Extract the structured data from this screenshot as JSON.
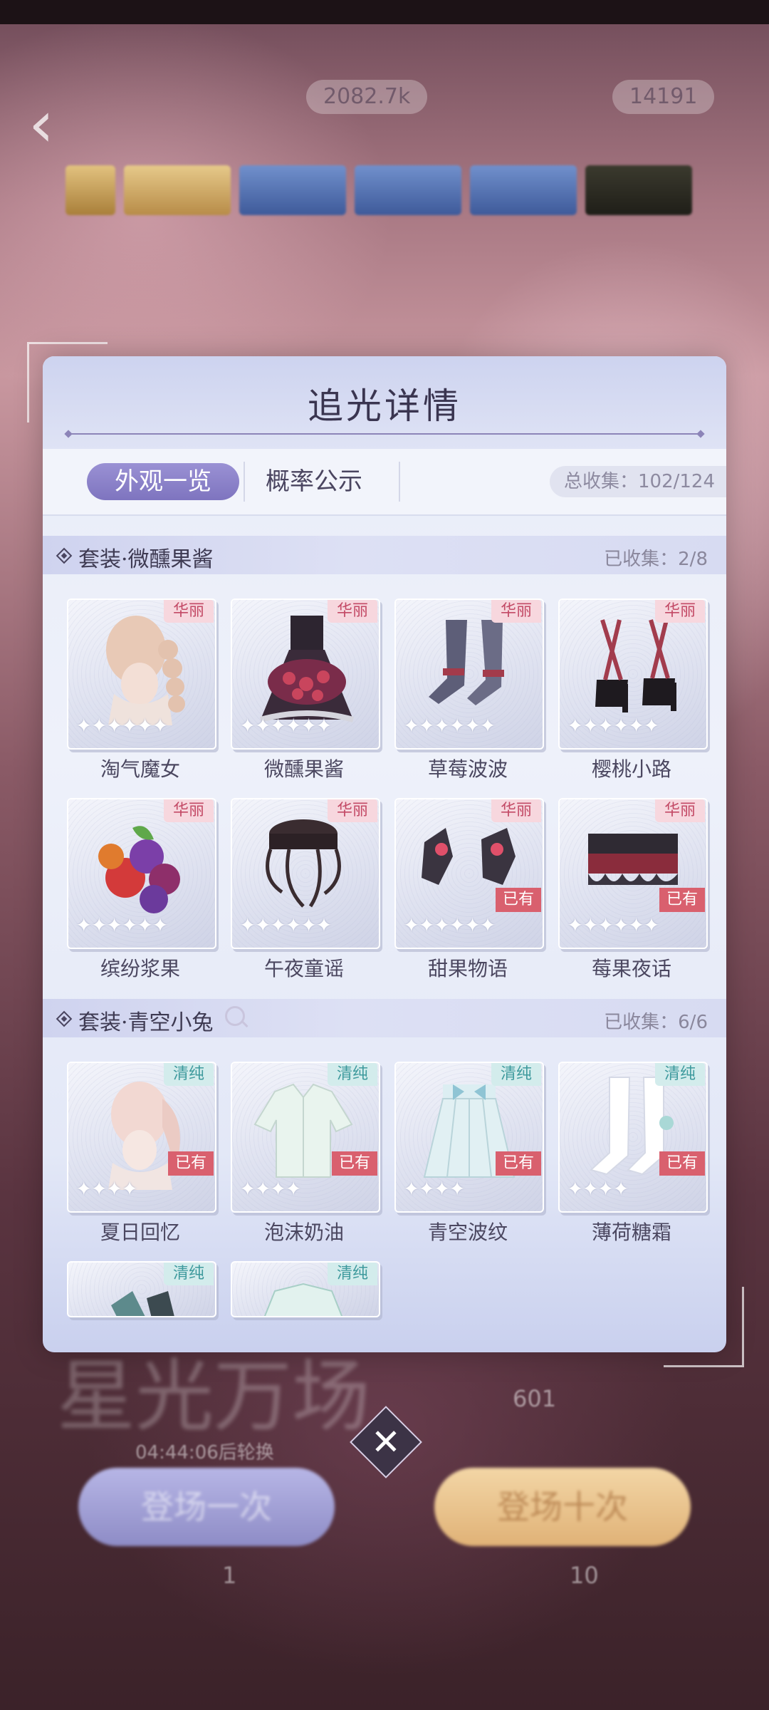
{
  "background": {
    "currency_gold": "2082.7k",
    "currency_gem": "14191",
    "blur_title": "星光万场",
    "ticket_count": "601",
    "button_once": "登场一次",
    "button_ten": "登场十次",
    "cost_once": "1",
    "cost_ten": "10",
    "timer": "04:44:06后轮换"
  },
  "dialog": {
    "title": "追光详情",
    "tabs": [
      {
        "label": "外观一览",
        "active": true
      },
      {
        "label": "概率公示",
        "active": false
      }
    ],
    "total_collected": "总收集：102/124"
  },
  "sections": [
    {
      "title": "套装·微醺果酱",
      "count": "已收集：2/8",
      "items": [
        {
          "name": "淘气魔女",
          "badge": "华丽",
          "badge_type": "gorgeous",
          "owned": false,
          "stars": 6,
          "icon": "pigtail-hair-icon"
        },
        {
          "name": "微醺果酱",
          "badge": "华丽",
          "badge_type": "gorgeous",
          "owned": false,
          "stars": 6,
          "icon": "dress-icon"
        },
        {
          "name": "草莓波波",
          "badge": "华丽",
          "badge_type": "gorgeous",
          "owned": false,
          "stars": 6,
          "icon": "socks-icon"
        },
        {
          "name": "樱桃小路",
          "badge": "华丽",
          "badge_type": "gorgeous",
          "owned": false,
          "stars": 6,
          "icon": "heels-icon"
        },
        {
          "name": "缤纷浆果",
          "badge": "华丽",
          "badge_type": "gorgeous",
          "owned": false,
          "stars": 6,
          "icon": "berries-icon"
        },
        {
          "name": "午夜童谣",
          "badge": "华丽",
          "badge_type": "gorgeous",
          "owned": false,
          "stars": 6,
          "icon": "choker-icon"
        },
        {
          "name": "甜果物语",
          "badge": "华丽",
          "badge_type": "gorgeous",
          "owned": true,
          "owned_label": "已有",
          "stars": 6,
          "icon": "earrings-icon"
        },
        {
          "name": "莓果夜话",
          "badge": "华丽",
          "badge_type": "gorgeous",
          "owned": true,
          "owned_label": "已有",
          "stars": 6,
          "icon": "frill-icon"
        }
      ]
    },
    {
      "title": "套装·青空小兔",
      "count": "已收集：6/6",
      "items": [
        {
          "name": "夏日回忆",
          "badge": "清纯",
          "badge_type": "pure",
          "owned": true,
          "owned_label": "已有",
          "stars": 4,
          "icon": "ponytail-hair-icon"
        },
        {
          "name": "泡沫奶油",
          "badge": "清纯",
          "badge_type": "pure",
          "owned": true,
          "owned_label": "已有",
          "stars": 4,
          "icon": "blouse-icon"
        },
        {
          "name": "青空波纹",
          "badge": "清纯",
          "badge_type": "pure",
          "owned": true,
          "owned_label": "已有",
          "stars": 4,
          "icon": "skirt-icon"
        },
        {
          "name": "薄荷糖霜",
          "badge": "清纯",
          "badge_type": "pure",
          "owned": true,
          "owned_label": "已有",
          "stars": 4,
          "icon": "stockings-icon"
        },
        {
          "name": "",
          "badge": "清纯",
          "badge_type": "pure",
          "owned": false,
          "stars": 0,
          "icon": "accessory-icon"
        },
        {
          "name": "",
          "badge": "清纯",
          "badge_type": "pure",
          "owned": false,
          "stars": 0,
          "icon": "coat-icon"
        }
      ]
    }
  ],
  "close_label": "✕"
}
